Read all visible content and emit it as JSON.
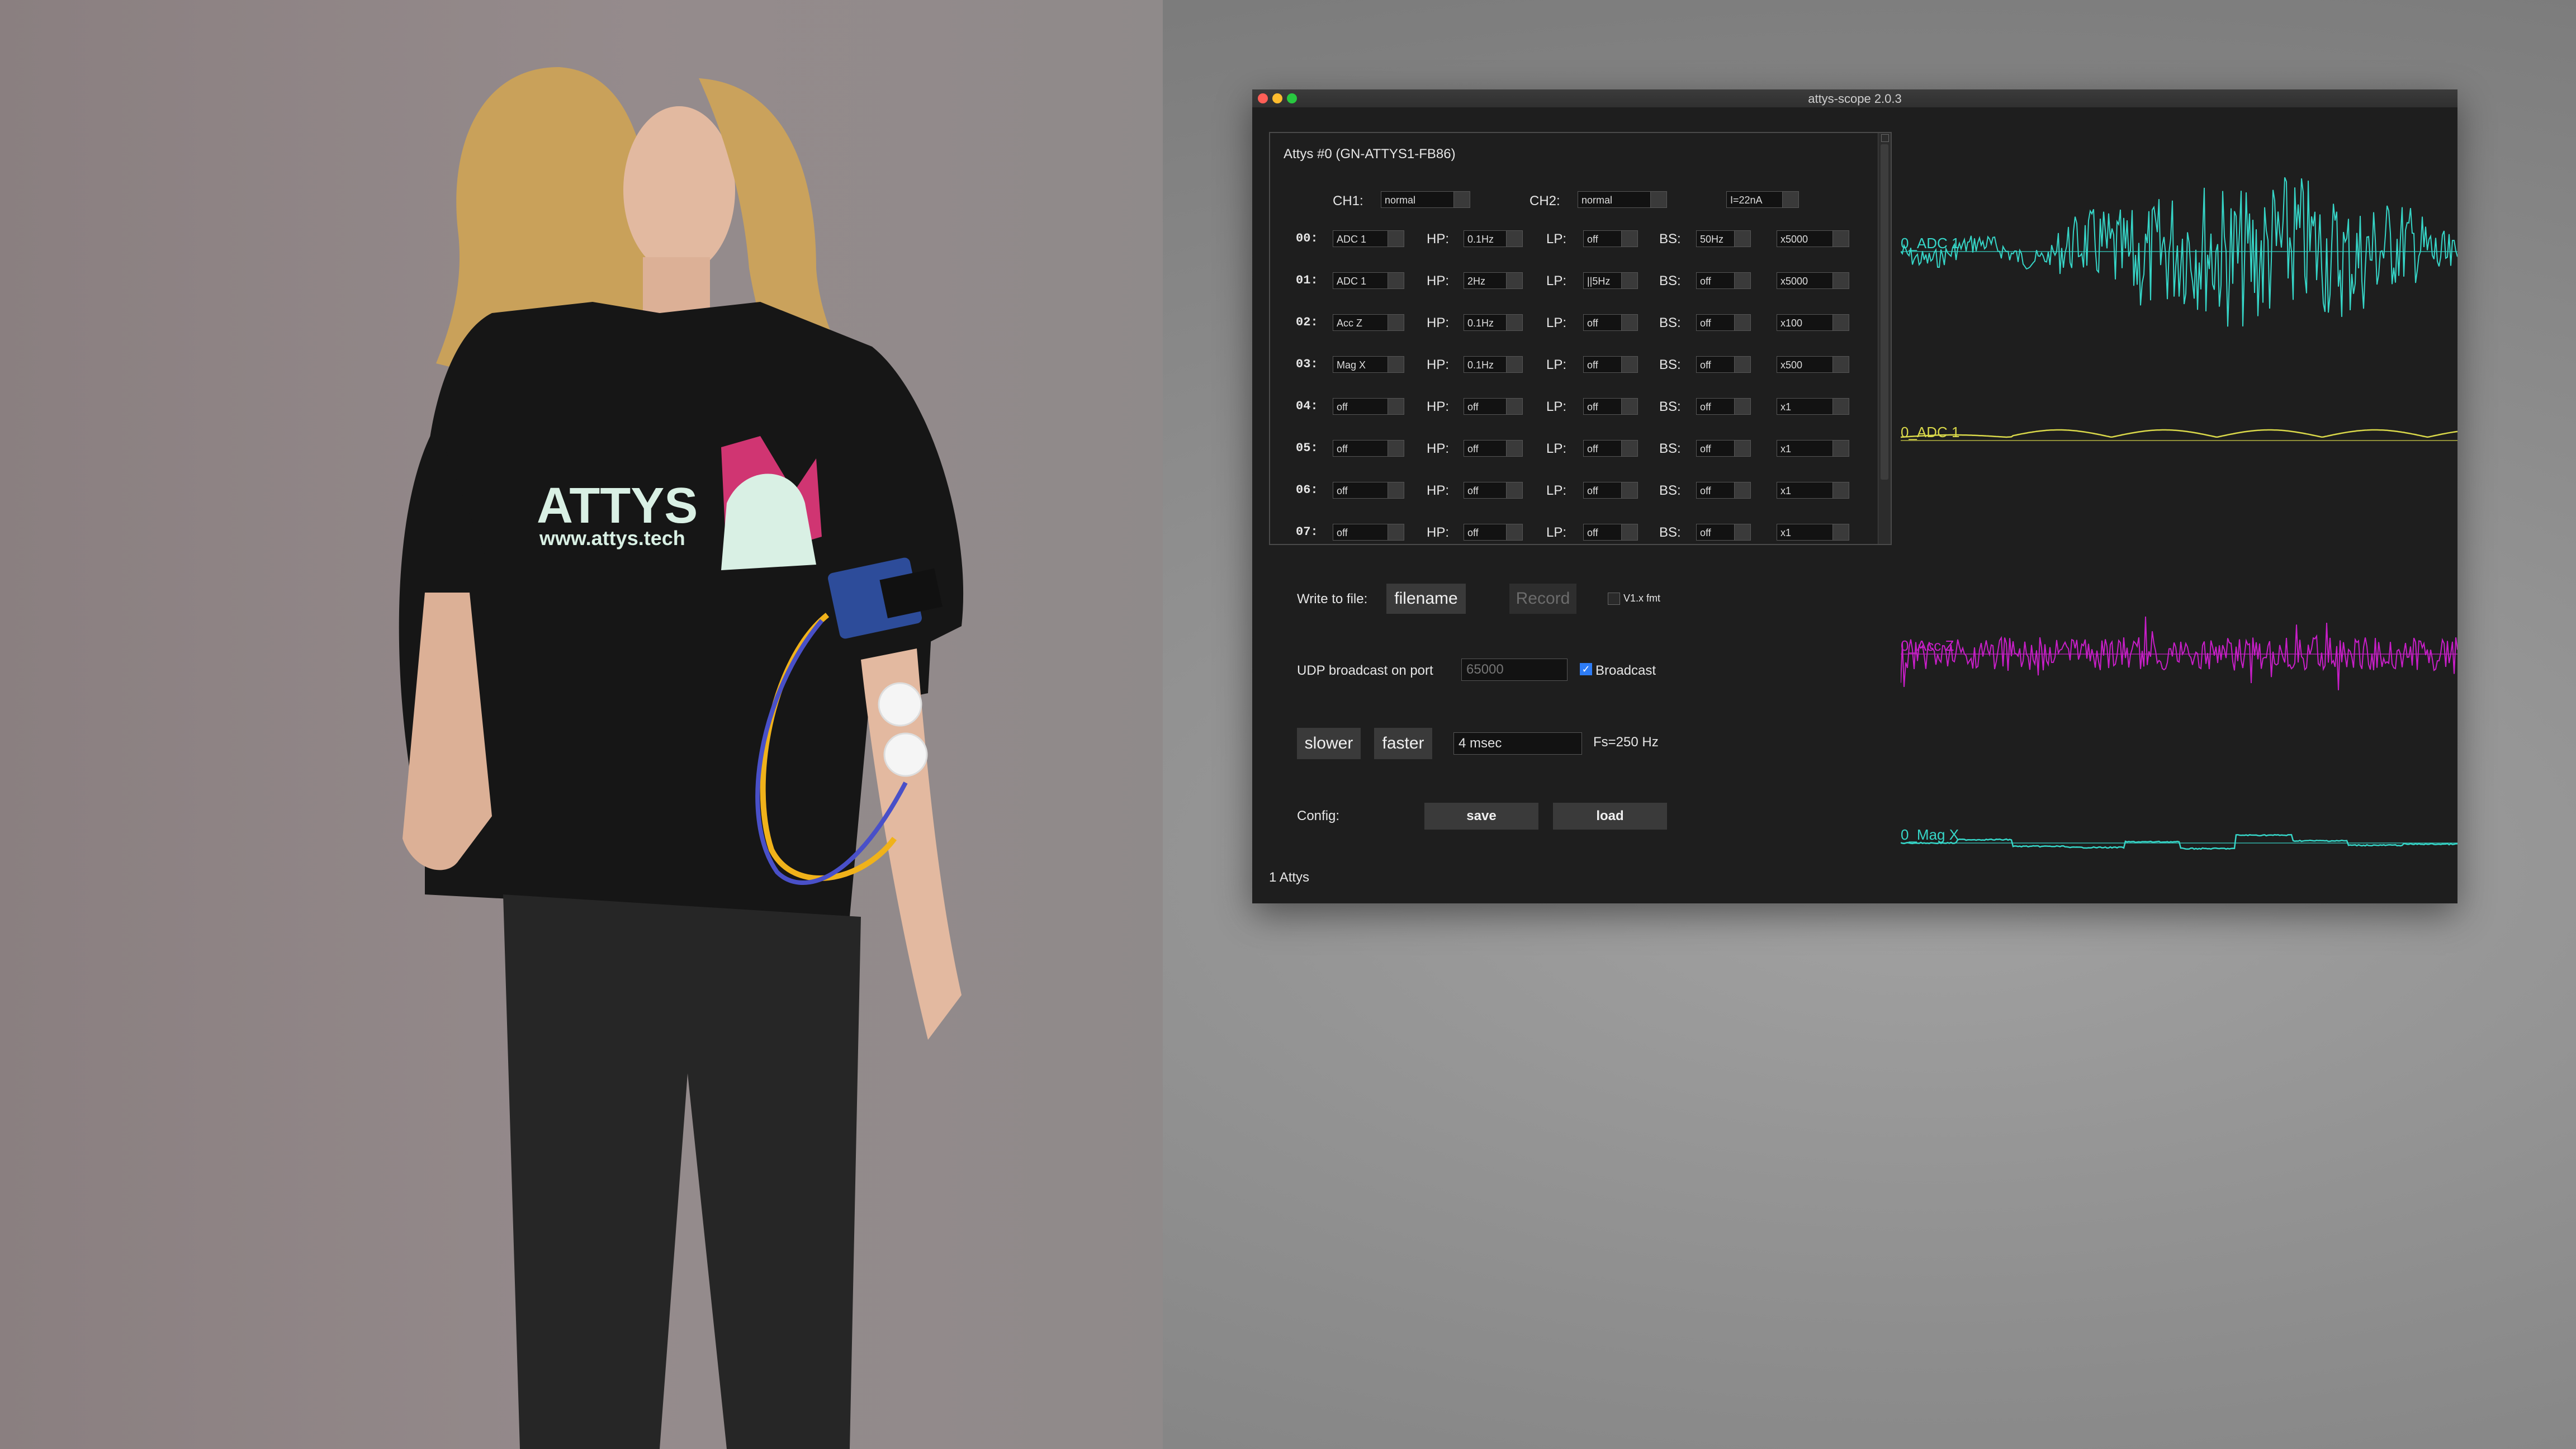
{
  "window": {
    "title": "attys-scope 2.0.3"
  },
  "panel": {
    "device_title": "Attys #0 (GN-ATTYS1-FB86)",
    "ch1_label": "CH1:",
    "ch1_value": "normal",
    "ch2_label": "CH2:",
    "ch2_value": "normal",
    "current_value": "I=22nA",
    "hp_label": "HP:",
    "lp_label": "LP:",
    "bs_label": "BS:",
    "rows": [
      {
        "idx": "00:",
        "source": "ADC 1",
        "hp": "0.1Hz",
        "lp": "off",
        "bs": "50Hz",
        "gain": "x5000"
      },
      {
        "idx": "01:",
        "source": "ADC 1",
        "hp": "2Hz",
        "lp": "||5Hz",
        "bs": "off",
        "gain": "x5000"
      },
      {
        "idx": "02:",
        "source": "Acc Z",
        "hp": "0.1Hz",
        "lp": "off",
        "bs": "off",
        "gain": "x100"
      },
      {
        "idx": "03:",
        "source": "Mag X",
        "hp": "0.1Hz",
        "lp": "off",
        "bs": "off",
        "gain": "x500"
      },
      {
        "idx": "04:",
        "source": "off",
        "hp": "off",
        "lp": "off",
        "bs": "off",
        "gain": "x1"
      },
      {
        "idx": "05:",
        "source": "off",
        "hp": "off",
        "lp": "off",
        "bs": "off",
        "gain": "x1"
      },
      {
        "idx": "06:",
        "source": "off",
        "hp": "off",
        "lp": "off",
        "bs": "off",
        "gain": "x1"
      },
      {
        "idx": "07:",
        "source": "off",
        "hp": "off",
        "lp": "off",
        "bs": "off",
        "gain": "x1"
      }
    ]
  },
  "controls": {
    "write_label": "Write to file:",
    "filename_button": "filename",
    "record_button": "Record",
    "v1_label": "V1.x fmt",
    "udp_label": "UDP broadcast on port",
    "udp_port_placeholder": "65000",
    "broadcast_label": "Broadcast",
    "broadcast_checked": true,
    "slower_button": "slower",
    "faster_button": "faster",
    "interval_value": "4 msec",
    "fs_label": "Fs=250 Hz",
    "config_label": "Config:",
    "save_button": "save",
    "load_button": "load",
    "status": "1 Attys"
  },
  "traces": [
    {
      "label": "0_ADC 1",
      "color": "#36d6c8"
    },
    {
      "label": "0_ADC 1",
      "color": "#d9d84a"
    },
    {
      "label": "0_Acc Z",
      "color": "#c81ec8"
    },
    {
      "label": "0_Mag X",
      "color": "#36d6c8"
    }
  ]
}
